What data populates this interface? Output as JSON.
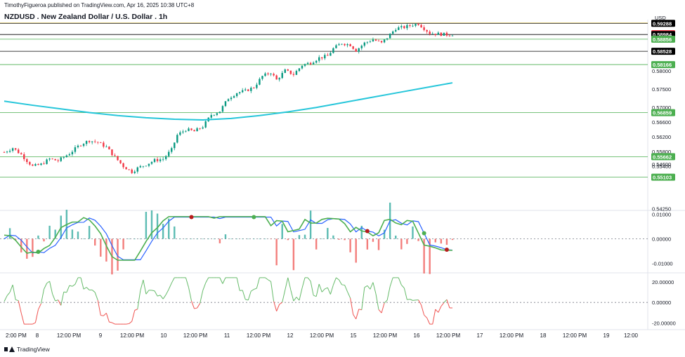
{
  "header": {
    "published": "TimothyFigueroa published on TradingView.com, Apr 16, 2025 10:38 UTC+8",
    "title": "NZDUSD . New Zealand Dollar / U.S. Dollar . 1h"
  },
  "footer": {
    "brand": "TradingView"
  },
  "chart_data": [
    {
      "type": "candlestick",
      "title": "NZDUSD . New Zealand Dollar / U.S. Dollar . 1h",
      "currency_label": "USD",
      "y_ticks": [
        0.58,
        0.575,
        0.57,
        0.566,
        0.562,
        0.558,
        0.554,
        0.5546,
        0.5425
      ],
      "y_tick_labels": [
        "0.58000",
        "0.57500",
        "0.57000",
        "0.56600",
        "0.56200",
        "0.55800",
        "0.55400",
        "0.54600",
        "0.54250"
      ],
      "ylim": [
        0.542,
        0.5935
      ],
      "x_tick_labels": [
        "2:00 PM",
        "8",
        "12:00 PM",
        "9",
        "12:00 PM",
        "10",
        "12:00 PM",
        "11",
        "12:00 PM",
        "12",
        "12:00 PM",
        "15",
        "12:00 PM",
        "16",
        "12:00 PM",
        "17",
        "12:00 PM",
        "18",
        "12:00 PM",
        "19",
        "12:00"
      ],
      "price_labels": [
        {
          "value": 0.59288,
          "text": "0.59288",
          "color": "#000000"
        },
        {
          "value": 0.59006,
          "text": "0.59006",
          "color": "#f23645"
        },
        {
          "value": 0.58984,
          "text": "0.58984",
          "color": "#000000"
        },
        {
          "value": 0.58856,
          "text": "0.58856",
          "color": "#4caf50"
        },
        {
          "value": 0.58528,
          "text": "0.58528",
          "color": "#000000"
        },
        {
          "value": 0.58166,
          "text": "0.58166",
          "color": "#4caf50"
        },
        {
          "value": 0.56859,
          "text": "0.56859",
          "color": "#4caf50"
        },
        {
          "value": 0.55662,
          "text": "0.55662",
          "color": "#4caf50"
        },
        {
          "value": 0.55103,
          "text": "0.55103",
          "color": "#4caf50"
        }
      ],
      "horizontal_levels": [
        {
          "value": 0.593,
          "color": "#f5d76e"
        },
        {
          "value": 0.59288,
          "color": "#000000"
        },
        {
          "value": 0.58984,
          "color": "#000000"
        },
        {
          "value": 0.58856,
          "color": "#4caf50"
        },
        {
          "value": 0.58528,
          "color": "#000000"
        },
        {
          "value": 0.58166,
          "color": "#4caf50"
        },
        {
          "value": 0.56859,
          "color": "#4caf50"
        },
        {
          "value": 0.55662,
          "color": "#4caf50"
        },
        {
          "value": 0.55103,
          "color": "#4caf50"
        }
      ],
      "moving_average": {
        "color": "#26c6da",
        "points": [
          [
            0,
            0.5717
          ],
          [
            10,
            0.5706
          ],
          [
            20,
            0.5696
          ],
          [
            30,
            0.5686
          ],
          [
            40,
            0.5678
          ],
          [
            50,
            0.5672
          ],
          [
            60,
            0.5668
          ],
          [
            70,
            0.5666
          ],
          [
            80,
            0.567
          ],
          [
            90,
            0.5678
          ],
          [
            100,
            0.5688
          ],
          [
            110,
            0.57
          ],
          [
            120,
            0.5714
          ],
          [
            130,
            0.5728
          ],
          [
            140,
            0.5742
          ],
          [
            150,
            0.5756
          ],
          [
            158,
            0.5767
          ]
        ]
      },
      "close_path": [
        [
          0,
          0.5578
        ],
        [
          3,
          0.559
        ],
        [
          6,
          0.5572
        ],
        [
          8,
          0.5555
        ],
        [
          10,
          0.554
        ],
        [
          13,
          0.5545
        ],
        [
          16,
          0.556
        ],
        [
          19,
          0.5555
        ],
        [
          23,
          0.5575
        ],
        [
          27,
          0.56
        ],
        [
          30,
          0.561
        ],
        [
          33,
          0.5605
        ],
        [
          36,
          0.5592
        ],
        [
          39,
          0.5565
        ],
        [
          42,
          0.554
        ],
        [
          45,
          0.5525
        ],
        [
          47,
          0.5535
        ],
        [
          50,
          0.5545
        ],
        [
          53,
          0.5556
        ],
        [
          56,
          0.556
        ],
        [
          59,
          0.5585
        ],
        [
          61,
          0.5625
        ],
        [
          64,
          0.564
        ],
        [
          67,
          0.5635
        ],
        [
          70,
          0.5648
        ],
        [
          73,
          0.568
        ],
        [
          76,
          0.569
        ],
        [
          79,
          0.5725
        ],
        [
          82,
          0.574
        ],
        [
          85,
          0.5745
        ],
        [
          88,
          0.5755
        ],
        [
          91,
          0.5785
        ],
        [
          94,
          0.5795
        ],
        [
          96,
          0.5775
        ],
        [
          99,
          0.58
        ],
        [
          102,
          0.579
        ],
        [
          105,
          0.5815
        ],
        [
          108,
          0.5822
        ],
        [
          111,
          0.5835
        ],
        [
          114,
          0.584
        ],
        [
          116,
          0.586
        ],
        [
          119,
          0.5875
        ],
        [
          122,
          0.587
        ],
        [
          124,
          0.5855
        ],
        [
          127,
          0.5875
        ],
        [
          130,
          0.5885
        ],
        [
          133,
          0.5875
        ],
        [
          135,
          0.589
        ],
        [
          138,
          0.5915
        ],
        [
          141,
          0.5918
        ],
        [
          144,
          0.5925
        ],
        [
          146,
          0.5928
        ],
        [
          148,
          0.5915
        ],
        [
          150,
          0.5902
        ],
        [
          153,
          0.59
        ],
        [
          156,
          0.5898
        ],
        [
          158,
          0.5899
        ]
      ]
    },
    {
      "type": "line",
      "name": "oscillator",
      "y_ticks": [
        0.01,
        0.0,
        -0.01
      ],
      "y_tick_labels": [
        "0.01000",
        "0.00000",
        "-0.01000"
      ],
      "ylim": [
        -0.0135,
        0.0115
      ]
    },
    {
      "type": "line",
      "name": "momentum",
      "y_ticks": [
        20.0,
        0.0,
        -20.0
      ],
      "y_tick_labels": [
        "20.00000",
        "0.00000",
        "-20.00000"
      ],
      "ylim": [
        -25,
        28
      ]
    }
  ],
  "colors": {
    "up": "#089981",
    "down": "#f23645",
    "ma": "#26c6da",
    "osc_green": "#4caf50",
    "osc_red": "#b71c1c",
    "osc_blue": "#2962ff"
  }
}
